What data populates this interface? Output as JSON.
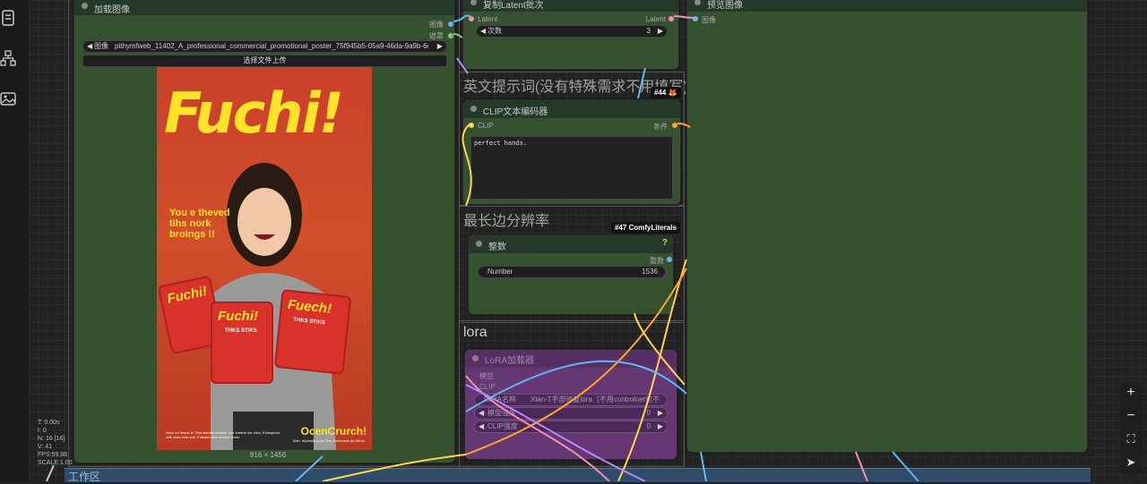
{
  "sidebar": {
    "icons": [
      "document-icon",
      "workflow-tree-icon",
      "image-gallery-icon"
    ]
  },
  "load_image_node": {
    "title": "加载图像",
    "outputs": [
      "图像",
      "遮罩"
    ],
    "image_label": "图像",
    "image_value": "pithymfweb_11402_A_professional_commercial_promotional_poster_75f945b5-05a9-46da-9a9b-6c7c0e...",
    "upload_button": "选择文件上传",
    "dimensions": "816 × 1456",
    "poster": {
      "brand": "Fuchi!",
      "tagline": "You e theved tihs nork broings !!",
      "bag_left": "Fuchi!",
      "bag_mid": "Fuchi!",
      "bag_right": "Fuech!",
      "bag_sub": "THKS STIKS",
      "footer_brand": "OcenCrurch!",
      "fine_print": "Noce lof Iinuon to Tiart starlets snocks, lore loretne loo otivo. Kinespodo with stats sost-soh. Faltotoh mos soturis doolo",
      "fine_print2": "Dcln. Wyfodding wo The Soofnoses an Winor"
    }
  },
  "latent_node": {
    "title": "复制Latent批次",
    "input": "Latent",
    "output": "Latent",
    "widget_label": "次数",
    "widget_value": "3"
  },
  "preview_node": {
    "title": "预览图像",
    "input": "图像"
  },
  "prompt_group": {
    "title": "英文提示词(没有特殊需求不用填写)",
    "badge": "#44 🦊"
  },
  "clip_node": {
    "title": "CLIP文本编码器",
    "input": "CLIP",
    "output": "条件",
    "text": "perfect hands."
  },
  "resolution_group": {
    "title": "最长边分辨率",
    "tooltip": "#47 ComfyLiterals"
  },
  "int_node": {
    "title": "整数",
    "help": "?",
    "output": "整数",
    "widget_label": "Number",
    "widget_value": "1536"
  },
  "lora_group": {
    "title": "lora"
  },
  "lora_node": {
    "title": "LoRA加载器",
    "inputs": [
      "模型",
      "CLIP"
    ],
    "lora_label": "LoRA名称",
    "lora_value": "Xlan-T手部修复lora（不用controlnet也不",
    "strength1_label": "模型强度",
    "strength1_value": "0",
    "strength2_label": "CLIP强度",
    "strength2_value": "0"
  },
  "stats": {
    "lines": "T: 0.00s\nI: 0\nN: 16 [16]\nV: 41\nFPS:59.88\nSCALE:1.00"
  },
  "bottom_group": {
    "title": "工作区"
  },
  "right_tools": [
    "+",
    "−",
    "⛶",
    "➤"
  ]
}
